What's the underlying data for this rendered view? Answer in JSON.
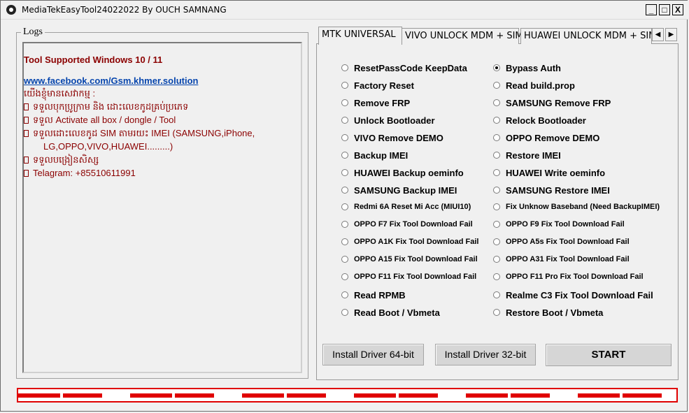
{
  "window": {
    "title": "MediaTekEasyTool24022022 By OUCH SAMNANG",
    "controls": {
      "minimize": "_",
      "maximize": "□",
      "close": "X"
    }
  },
  "logs": {
    "legend": "Logs",
    "lines": [
      "Tool Supported Windows 10 / 11",
      "www.facebook.com/Gsm.khmer.solution",
      "យើងខ្ញុំមានសេវាកម្ម :",
      "ទទួលបុកប្រូក្រាម និង ដោះលេខកូដគ្រប់ប្រភេទ",
      "ទទួល Activate all box / dongle / Tool",
      "ទទួលដោះលេខកូដ SIM តាមរយះ IMEI (SAMSUNG,iPhone,",
      "LG,OPPO,VIVO,HUAWEI.........)",
      "ទទួលបង្រៀនសិស្ស",
      "Telagram: +85510611991"
    ]
  },
  "tabs": {
    "items": [
      "MTK UNIVERSAL",
      "VIVO UNLOCK MDM + SIM",
      "HUAWEI UNLOCK MDM + SIM"
    ],
    "active": 0,
    "scroll_left": "◀",
    "scroll_right": "▶"
  },
  "options": {
    "left": [
      "ResetPassCode KeepData",
      "Factory Reset",
      "Remove FRP",
      "Unlock Bootloader",
      "VIVO Remove DEMO",
      "Backup IMEI",
      "HUAWEI Backup oeminfo",
      "SAMSUNG Backup IMEI",
      "Redmi 6A Reset Mi Acc (MIUI10)",
      "OPPO F7 Fix Tool Download Fail",
      "OPPO A1K Fix Tool Download Fail",
      "OPPO A15 Fix Tool Download Fail",
      "OPPO F11 Fix Tool Download Fail",
      "Read RPMB",
      "Read Boot / Vbmeta"
    ],
    "right": [
      "Bypass Auth",
      "Read build.prop",
      "SAMSUNG Remove FRP",
      "Relock Bootloader",
      "OPPO Remove DEMO",
      "Restore IMEI",
      "HUAWEI Write oeminfo",
      "SAMSUNG Restore IMEI",
      "Fix Unknow Baseband (Need BackupIMEI)",
      "OPPO F9 Fix Tool Download Fail",
      "OPPO A5s Fix Tool Download Fail",
      "OPPO A31 Fix Tool Download Fail",
      "OPPO F11 Pro Fix Tool Download Fail",
      "Realme C3 Fix Tool Download Fail",
      "Restore Boot / Vbmeta"
    ],
    "selected": "Bypass Auth"
  },
  "buttons": {
    "driver64": "Install Driver 64-bit",
    "driver32": "Install Driver 32-bit",
    "start": "START"
  },
  "colors": {
    "log_text": "#8b0000",
    "link": "#0645ad",
    "progress_border": "#e00000"
  }
}
